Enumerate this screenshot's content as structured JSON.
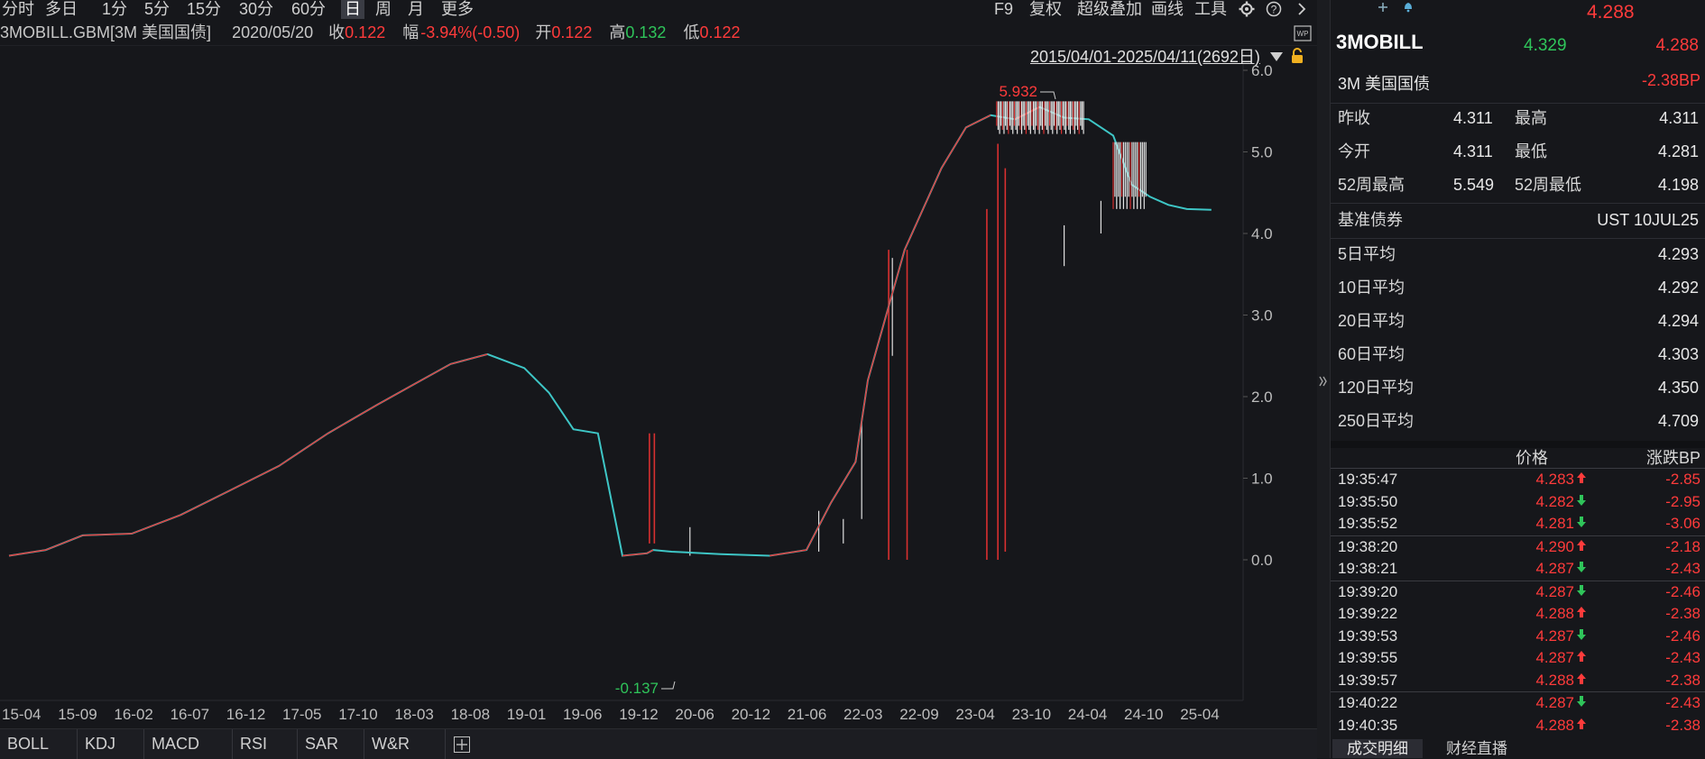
{
  "toolbar": {
    "timeframes": [
      "分时",
      "多日",
      "1分",
      "5分",
      "15分",
      "30分",
      "60分",
      "日",
      "周",
      "月",
      "更多"
    ],
    "active_index": 7,
    "tools": [
      "F9",
      "复权",
      "超级叠加",
      "画线",
      "工具"
    ]
  },
  "info": {
    "symbol": "3MOBILL.GBM[3M 美国国债]",
    "date": "2020/05/20",
    "close_label": "收",
    "close": "0.122",
    "range_label": "幅",
    "range": "-3.94%(-0.50)",
    "open_label": "开",
    "open": "0.122",
    "high_label": "高",
    "high": "0.132",
    "low_label": "低",
    "low": "0.122"
  },
  "chart_data": {
    "type": "line",
    "date_range": "2015/04/01-2025/04/11(2692日)",
    "x_ticks": [
      "15-04",
      "15-09",
      "16-02",
      "16-07",
      "16-12",
      "17-05",
      "17-10",
      "18-03",
      "18-08",
      "19-01",
      "19-06",
      "19-12",
      "20-06",
      "20-12",
      "21-06",
      "22-03",
      "22-09",
      "23-04",
      "23-10",
      "24-04",
      "24-10",
      "25-04"
    ],
    "y_ticks": [
      "6.0",
      "5.0",
      "4.0",
      "3.0",
      "2.0",
      "1.0",
      "0.0"
    ],
    "ylim": [
      -0.25,
      6.1
    ],
    "max_label": "5.932",
    "min_label": "-0.137",
    "series": [
      {
        "x": [
          0,
          0.03,
          0.06,
          0.1,
          0.14,
          0.18,
          0.22,
          0.26,
          0.3,
          0.33,
          0.36,
          0.39,
          0.42,
          0.44,
          0.46,
          0.48,
          0.5,
          0.52,
          0.525,
          0.54,
          0.58,
          0.62,
          0.65,
          0.67,
          0.69,
          0.7,
          0.715,
          0.73,
          0.745,
          0.76,
          0.78,
          0.8,
          0.82,
          0.84,
          0.86,
          0.88,
          0.9,
          0.915,
          0.93,
          0.945,
          0.96,
          0.98
        ],
        "y": [
          0.05,
          0.12,
          0.3,
          0.32,
          0.55,
          0.85,
          1.15,
          1.55,
          1.9,
          2.15,
          2.4,
          2.52,
          2.35,
          2.05,
          1.6,
          1.55,
          0.05,
          0.08,
          0.12,
          0.1,
          0.07,
          0.05,
          0.12,
          0.7,
          1.2,
          2.2,
          3.0,
          3.8,
          4.3,
          4.8,
          5.3,
          5.45,
          5.4,
          5.55,
          5.42,
          5.4,
          5.2,
          4.6,
          4.45,
          4.35,
          4.3,
          4.29
        ]
      }
    ]
  },
  "indicators": [
    "BOLL",
    "KDJ",
    "MACD",
    "RSI",
    "SAR",
    "W&R"
  ],
  "panel": {
    "top_price": "4.288",
    "name": "3MOBILL",
    "bid": "4.329",
    "last": "4.288",
    "full_name": "3M 美国国债",
    "change_bp": "-2.38BP",
    "stats": [
      {
        "l1": "昨收",
        "v1": "4.311",
        "c1": "white",
        "l2": "最高",
        "v2": "4.311",
        "c2": "red"
      },
      {
        "l1": "今开",
        "v1": "4.311",
        "c1": "red",
        "l2": "最低",
        "v2": "4.281",
        "c2": "red"
      },
      {
        "l1": "52周最高",
        "v1": "5.549",
        "c1": "white",
        "l2": "52周最低",
        "v2": "4.198",
        "c2": "white"
      }
    ],
    "benchmark_label": "基准债券",
    "benchmark": "UST 10JUL25",
    "averages": [
      {
        "label": "5日平均",
        "value": "4.293"
      },
      {
        "label": "10日平均",
        "value": "4.292"
      },
      {
        "label": "20日平均",
        "value": "4.294"
      },
      {
        "label": "60日平均",
        "value": "4.303"
      },
      {
        "label": "120日平均",
        "value": "4.350"
      },
      {
        "label": "250日平均",
        "value": "4.709"
      }
    ],
    "tick_header_price": "价格",
    "tick_header_change": "涨跌BP",
    "ticks": [
      {
        "t": "19:35:47",
        "p": "4.283",
        "d": "up",
        "c": "-2.85"
      },
      {
        "t": "19:35:50",
        "p": "4.282",
        "d": "down",
        "c": "-2.95"
      },
      {
        "t": "19:35:52",
        "p": "4.281",
        "d": "down",
        "c": "-3.06"
      },
      {
        "t": "19:38:20",
        "p": "4.290",
        "d": "up",
        "c": "-2.18"
      },
      {
        "t": "19:38:21",
        "p": "4.287",
        "d": "down",
        "c": "-2.43"
      },
      {
        "t": "19:39:20",
        "p": "4.287",
        "d": "down",
        "c": "-2.46"
      },
      {
        "t": "19:39:22",
        "p": "4.288",
        "d": "up",
        "c": "-2.38"
      },
      {
        "t": "19:39:53",
        "p": "4.287",
        "d": "down",
        "c": "-2.46"
      },
      {
        "t": "19:39:55",
        "p": "4.287",
        "d": "up",
        "c": "-2.43"
      },
      {
        "t": "19:39:57",
        "p": "4.288",
        "d": "up",
        "c": "-2.38"
      },
      {
        "t": "19:40:22",
        "p": "4.287",
        "d": "down",
        "c": "-2.43"
      },
      {
        "t": "19:40:35",
        "p": "4.288",
        "d": "up",
        "c": "-2.38"
      }
    ],
    "bottom_tabs": [
      "成交明细",
      "财经直播"
    ]
  }
}
